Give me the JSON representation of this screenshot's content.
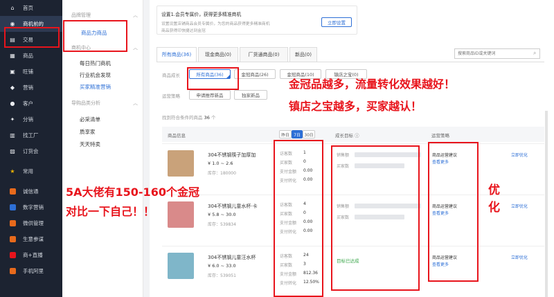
{
  "sidebar": {
    "items": [
      {
        "label": "首页",
        "icon": "home-icon",
        "glyph": "⌂"
      },
      {
        "label": "商机前的",
        "icon": "opportunity-icon",
        "glyph": "◉",
        "active": true
      },
      {
        "label": "交易",
        "icon": "trade-icon",
        "glyph": "▤"
      },
      {
        "label": "商品",
        "icon": "goods-icon",
        "glyph": "▦"
      },
      {
        "label": "旺铺",
        "icon": "shop-icon",
        "glyph": "▣"
      },
      {
        "label": "营销",
        "icon": "marketing-icon",
        "glyph": "◆"
      },
      {
        "label": "客户",
        "icon": "customer-icon",
        "glyph": "●"
      },
      {
        "label": "分销",
        "icon": "distribution-icon",
        "glyph": "✦"
      },
      {
        "label": "找工厂",
        "icon": "factory-icon",
        "glyph": "▥"
      },
      {
        "label": "订货会",
        "icon": "order-fair-icon",
        "glyph": "▨"
      },
      {
        "label": "常用",
        "icon": "star-icon",
        "glyph": "★"
      },
      {
        "label": "诚信通",
        "icon": "chengxintong-icon",
        "color": "#e86a1c"
      },
      {
        "label": "数字营销",
        "icon": "digital-marketing-icon",
        "color": "#2d6fd6"
      },
      {
        "label": "微供管理",
        "icon": "weigong-icon",
        "color": "#e86a1c"
      },
      {
        "label": "生意参谋",
        "icon": "business-advisor-icon",
        "color": "#e86a1c"
      },
      {
        "label": "商+直播",
        "icon": "live-icon",
        "color": "#e8141c"
      },
      {
        "label": "手机阿里",
        "icon": "mobile-icon",
        "color": "#e86a1c"
      }
    ]
  },
  "subnav": {
    "head1": "品牌管理",
    "item_product": "商品力商品",
    "head2": "商机中心",
    "item_hot": "每日热门商机",
    "item_industry": "行业机会发现",
    "item_buyer": "买家精准营销",
    "head3": "导购品类分析",
    "item_must": "必采清单",
    "item_quality": "质享家",
    "item_daily": "天天特卖"
  },
  "notice": {
    "line1": "设置1.会员专属价，获得更多精准商机",
    "line2": "设置设置店铺商品会员专属价，为您的商品获得更多精准商机",
    "line3": "商品获得印快捷达到金冠",
    "button": "立即设置"
  },
  "tabs": [
    "所有商品(36)",
    "现金商品(0)",
    "厂货通商品(0)",
    "新品(0)"
  ],
  "search": {
    "placeholder": "搜索商品ID或关键词"
  },
  "filter": {
    "label1": "商品成长",
    "pills": [
      "所有商品(36)",
      "金冠商品(26)",
      "金冠商品(10)",
      "镇店之宝(0)"
    ],
    "label2": "运营策略",
    "pills2": [
      "申请推荐新品",
      "独家新品"
    ],
    "count_prefix": "找到符合条件的商品",
    "count": "36",
    "count_suffix": "个"
  },
  "table": {
    "col_info": "商品信息",
    "ranges": [
      "昨日",
      "7日",
      "30日"
    ],
    "col_growth": "成长目标",
    "col_strategy": "运营策略",
    "metric_labels": [
      "访客数",
      "买家数",
      "支付金额",
      "支付转化"
    ],
    "growth_labels": [
      "销售额",
      "买家数"
    ],
    "suggest": "商品运营建议",
    "more": "查看更多",
    "optimize": "立即优化",
    "rows": [
      {
        "title": "304不锈钢筷子加厚加",
        "price": "¥ 1.0 ~ 2.6",
        "stock": "库存：180000",
        "metrics": [
          "1",
          "0",
          "0.00",
          "0.00"
        ],
        "growth": "",
        "thumb": "#c9a27a"
      },
      {
        "title": "304不锈钢儿童水杯·卡",
        "price": "¥ 5.8 ~ 30.0",
        "stock": "库存：539834",
        "metrics": [
          "4",
          "0",
          "0.00",
          "0.00"
        ],
        "growth": "",
        "thumb": "#d98a8a"
      },
      {
        "title": "304不锈钢儿童汪水杯",
        "price": "¥ 6.0 ~ 33.0",
        "stock": "库存：539051",
        "metrics": [
          "24",
          "3",
          "812.36",
          "12.50%"
        ],
        "growth": "目标已达成",
        "thumb": "#7fb6c9"
      }
    ]
  },
  "annotations": {
    "top": "金冠品越多，流量转化效果越好！",
    "top2": "镇店之宝越多，买家越认！",
    "left1": "5A大佬有150-160个金冠",
    "left2": "对比一下自己！！",
    "right": "优化"
  },
  "colors": {
    "accent": "#2d6fd6",
    "annotation": "#e8141c",
    "sidebar": "#1c2331"
  }
}
